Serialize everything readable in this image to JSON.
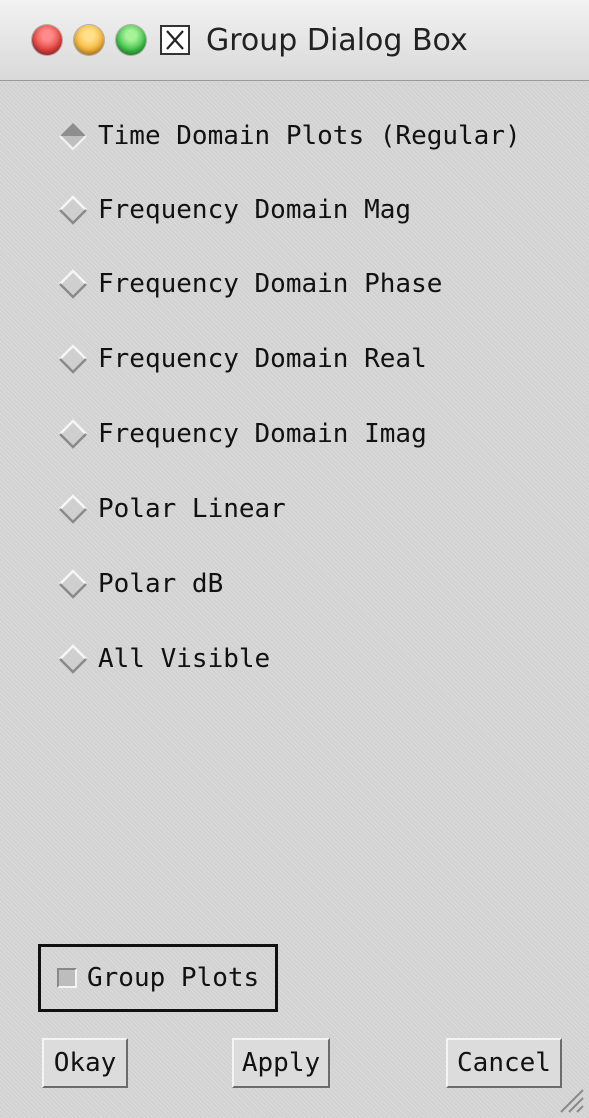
{
  "window": {
    "title": "Group Dialog Box"
  },
  "titlebar_icons": [
    "close-dot",
    "minimize-dot",
    "zoom-dot",
    "x11-icon"
  ],
  "radio_options": [
    {
      "label": "Time Domain Plots (Regular)",
      "selected": true
    },
    {
      "label": "Frequency Domain Mag",
      "selected": false
    },
    {
      "label": "Frequency Domain Phase",
      "selected": false
    },
    {
      "label": "Frequency Domain Real",
      "selected": false
    },
    {
      "label": "Frequency Domain Imag",
      "selected": false
    },
    {
      "label": "Polar Linear",
      "selected": false
    },
    {
      "label": "Polar dB",
      "selected": false
    },
    {
      "label": "All Visible",
      "selected": false
    }
  ],
  "group_checkbox": {
    "label": "Group Plots",
    "checked": false
  },
  "buttons": {
    "okay": "Okay",
    "apply": "Apply",
    "cancel": "Cancel"
  },
  "colors": {
    "background": "#d6d6d6",
    "border": "#111111",
    "traffic_red": "#e0443e",
    "traffic_yellow": "#f5b53a",
    "traffic_green": "#3fc24a"
  }
}
